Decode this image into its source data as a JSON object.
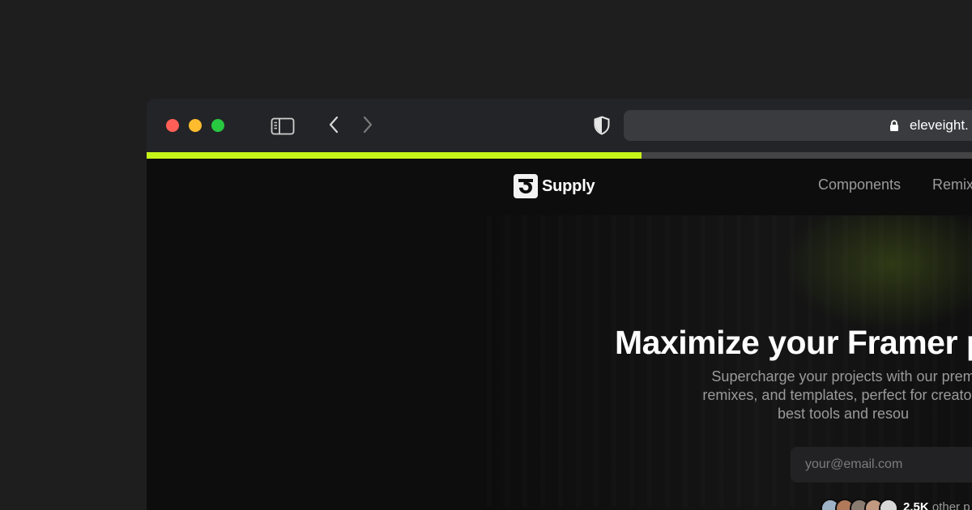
{
  "browser": {
    "address": "eleveight.",
    "load_progress": 0.6
  },
  "site": {
    "brand_name": "Supply",
    "nav": [
      {
        "label": "Components"
      },
      {
        "label": "Remix"
      }
    ]
  },
  "hero": {
    "headline": "Maximize your Framer p",
    "subtext_lines": [
      "Supercharge your projects with our prem",
      "remixes, and templates, perfect for creators",
      "best tools and resou"
    ],
    "email_placeholder": "your@email.com",
    "social_count": "2.5K",
    "social_suffix": "other p"
  },
  "colors": {
    "accent": "#c6f51a",
    "traffic_red": "#ff5f57",
    "traffic_yellow": "#febc2e",
    "traffic_green": "#28c840"
  },
  "avatar_colors": [
    "#9fb3c8",
    "#b07a5a",
    "#8a7b70",
    "#c29a82",
    "#d8d8d8"
  ]
}
